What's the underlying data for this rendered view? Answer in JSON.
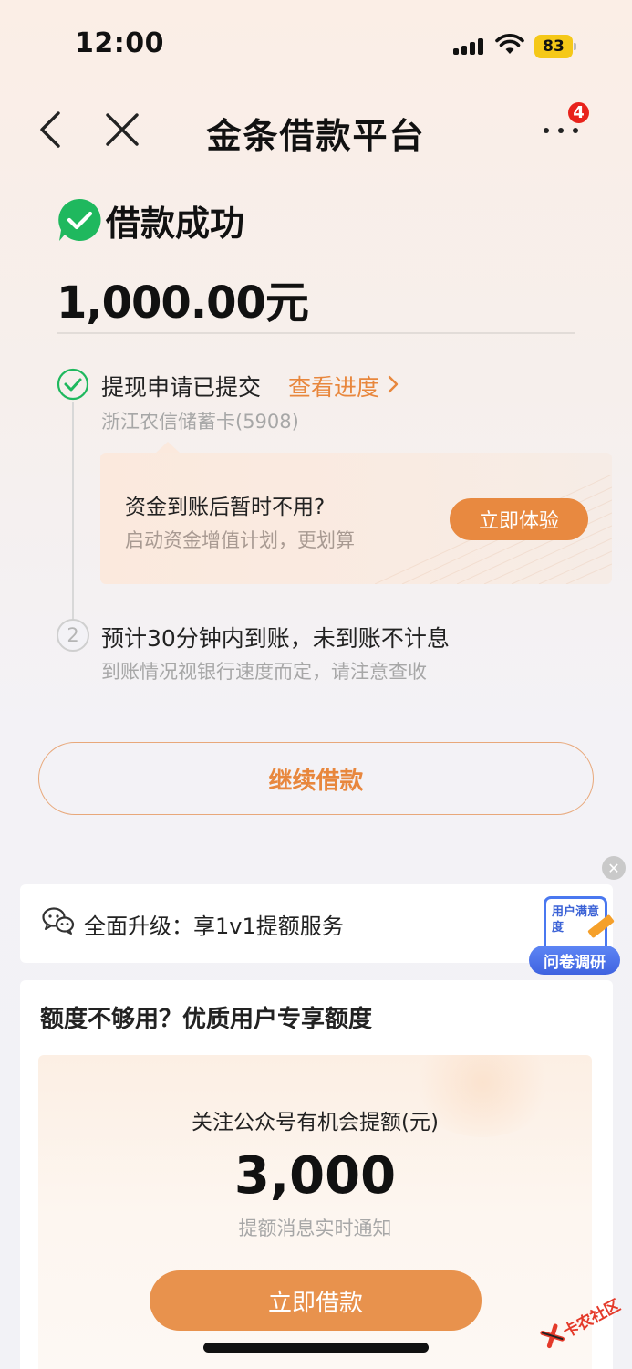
{
  "status_bar": {
    "time": "12:00",
    "battery": "83"
  },
  "nav": {
    "title": "金条借款平台",
    "badge_count": "4"
  },
  "result": {
    "title": "借款成功",
    "amount": "1,000.00元"
  },
  "steps": [
    {
      "number": "",
      "title": "提现申请已提交",
      "link": "查看进度",
      "subtitle": "浙江农信储蓄卡(5908)"
    },
    {
      "number": "2",
      "title": "预计30分钟内到账，未到账不计息",
      "subtitle": "到账情况视银行速度而定，请注意查收"
    }
  ],
  "promo": {
    "title": "资金到账后暂时不用?",
    "subtitle": "启动资金增值计划，更划算",
    "button": "立即体验"
  },
  "continue_button": "继续借款",
  "service": {
    "text": "全面升级：享1v1提额服务"
  },
  "survey": {
    "card_text": "用户满意度",
    "label": "问卷调研"
  },
  "quota": {
    "title": "额度不够用？优质用户专享额度",
    "label": "关注公众号有机会提额(元)",
    "amount": "3,000",
    "note": "提额消息实时通知",
    "button": "立即借款"
  },
  "watermark": "卡农社区",
  "colors": {
    "accent": "#e8873d",
    "success": "#1fb85e",
    "badge": "#e8231c",
    "survey_blue": "#4a78f0"
  }
}
